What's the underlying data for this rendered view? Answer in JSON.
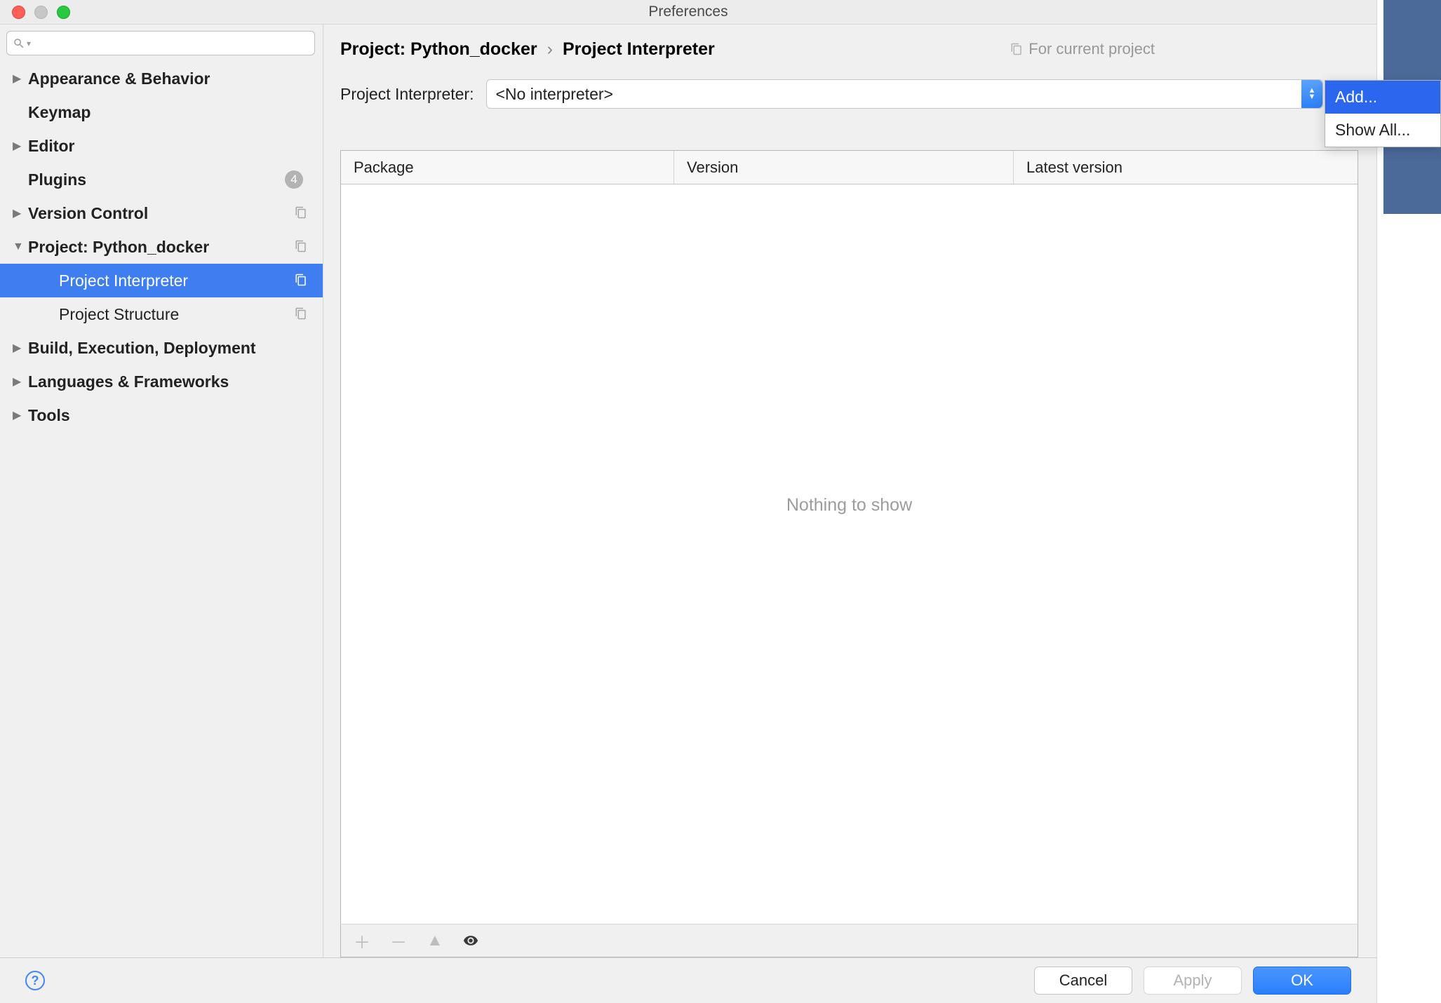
{
  "window": {
    "title": "Preferences"
  },
  "sidebar": {
    "items": [
      {
        "label": "Appearance & Behavior",
        "expandable": true,
        "bold": true
      },
      {
        "label": "Keymap",
        "expandable": false,
        "bold": true
      },
      {
        "label": "Editor",
        "expandable": true,
        "bold": true
      },
      {
        "label": "Plugins",
        "expandable": false,
        "bold": true,
        "badge": "4"
      },
      {
        "label": "Version Control",
        "expandable": true,
        "bold": true,
        "copy": true
      },
      {
        "label": "Project: Python_docker",
        "expandable": true,
        "expanded": true,
        "bold": true,
        "copy": true
      },
      {
        "label": "Project Interpreter",
        "sub": true,
        "selected": true,
        "copy": true
      },
      {
        "label": "Project Structure",
        "sub": true,
        "copy": true
      },
      {
        "label": "Build, Execution, Deployment",
        "expandable": true,
        "bold": true
      },
      {
        "label": "Languages & Frameworks",
        "expandable": true,
        "bold": true
      },
      {
        "label": "Tools",
        "expandable": true,
        "bold": true
      }
    ]
  },
  "breadcrumb": {
    "project": "Project: Python_docker",
    "sep": "›",
    "page": "Project Interpreter"
  },
  "for_project": "For current project",
  "interpreter": {
    "label": "Project Interpreter:",
    "value": "<No interpreter>"
  },
  "table": {
    "columns": {
      "package": "Package",
      "version": "Version",
      "latest": "Latest version"
    },
    "empty": "Nothing to show"
  },
  "footer": {
    "cancel": "Cancel",
    "apply": "Apply",
    "ok": "OK"
  },
  "popup": {
    "add": "Add...",
    "show_all": "Show All..."
  },
  "colors": {
    "accent": "#2b7fff",
    "selection": "#2b66ef"
  }
}
